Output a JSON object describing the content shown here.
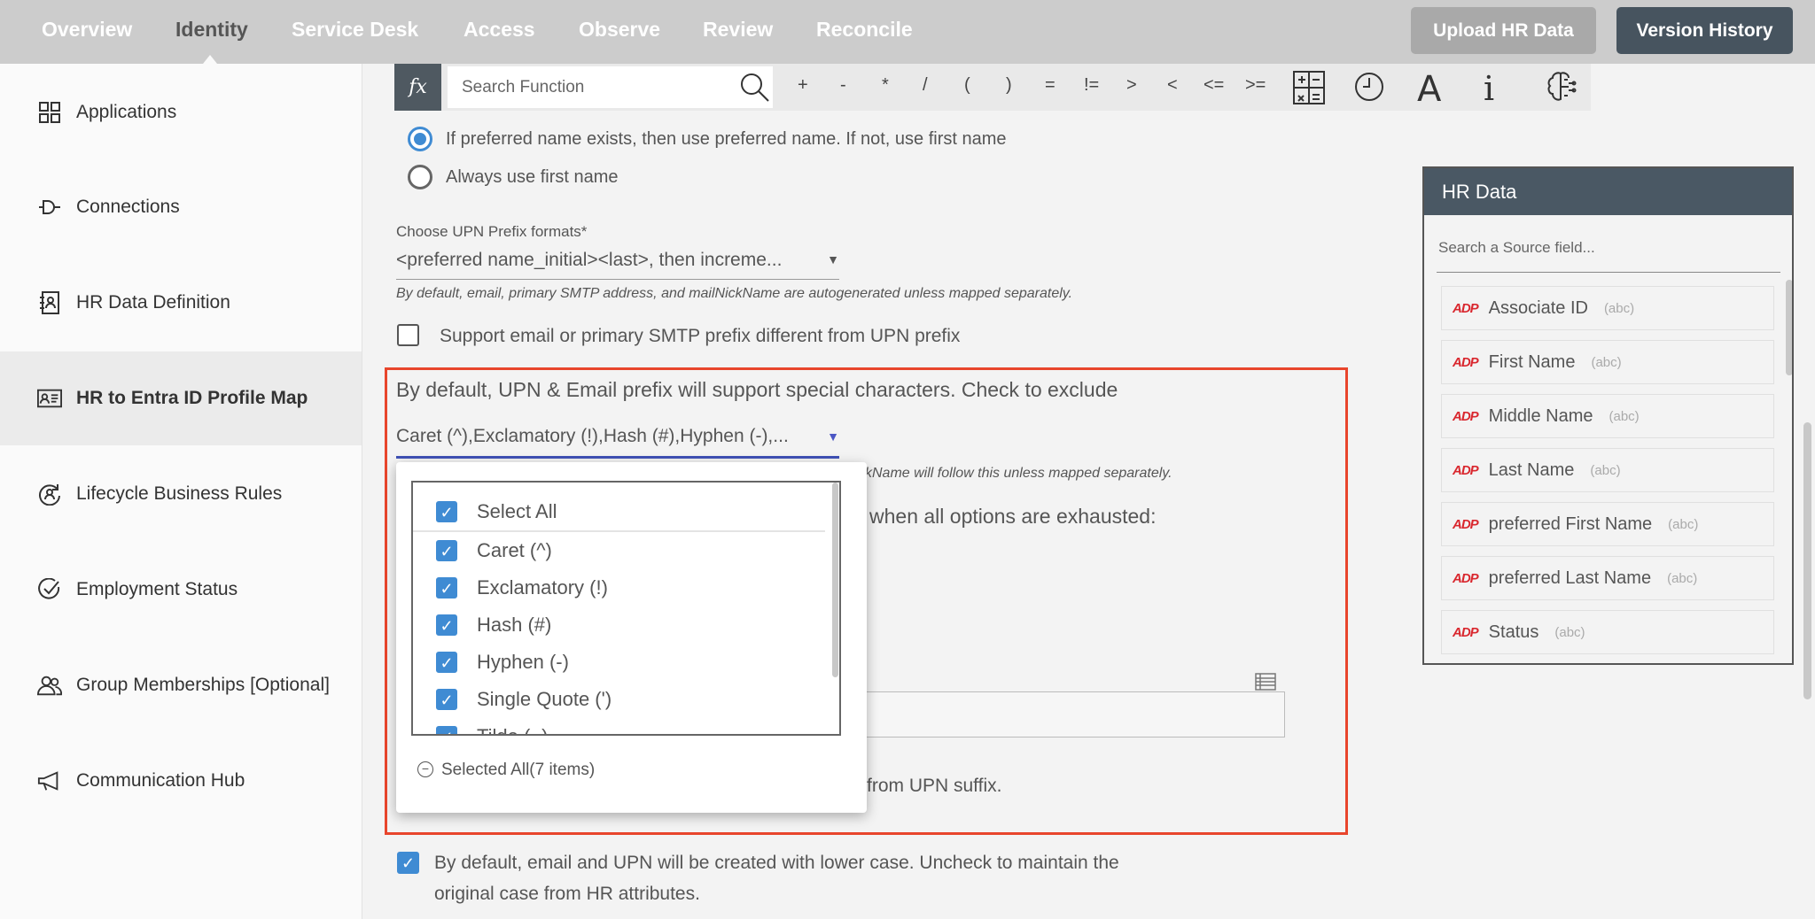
{
  "nav": {
    "tabs": [
      "Overview",
      "Identity",
      "Service Desk",
      "Access",
      "Observe",
      "Review",
      "Reconcile"
    ],
    "active": "Identity",
    "upload_label": "Upload HR Data",
    "version_label": "Version History"
  },
  "sidebar": {
    "items": [
      {
        "label": "Applications",
        "icon": "grid-icon"
      },
      {
        "label": "Connections",
        "icon": "plug-icon"
      },
      {
        "label": "HR Data Definition",
        "icon": "contact-book-icon"
      },
      {
        "label": "HR to Entra ID Profile Map",
        "icon": "id-card-icon"
      },
      {
        "label": "Lifecycle Business Rules",
        "icon": "lifecycle-icon"
      },
      {
        "label": "Employment Status",
        "icon": "check-circle-icon"
      },
      {
        "label": "Group Memberships [Optional]",
        "icon": "users-icon"
      },
      {
        "label": "Communication Hub",
        "icon": "megaphone-icon"
      }
    ],
    "active": "HR to Entra ID Profile Map"
  },
  "toolbar": {
    "fx_label": "fx",
    "search_placeholder": "Search Function",
    "operators": [
      "+",
      "-",
      "*",
      "/",
      "(",
      ")",
      "=",
      "!=",
      ">",
      "<",
      "<=",
      ">="
    ],
    "icons": [
      "calculator-icon",
      "clock-icon",
      "text-icon",
      "info-icon",
      "brain-icon"
    ]
  },
  "form": {
    "radio_preferred": "If preferred name exists, then use preferred name. If not, use first name",
    "radio_first": "Always use first name",
    "radio_selected": "preferred",
    "upn_label": "Choose UPN Prefix formats*",
    "upn_value": "<preferred name_initial><last>, then increme...",
    "upn_help": "By default, email, primary SMTP address, and mailNickName are autogenerated unless mapped separately.",
    "support_smtp_label": "Support email or primary SMTP prefix different from UPN prefix",
    "support_smtp_checked": false,
    "special_heading": "By default, UPN & Email prefix will support special characters. Check to exclude",
    "special_value": "Caret (^),Exclamatory (!),Hash (#),Hyphen (-),...",
    "special_help_fragment": "ckName will follow this unless mapped separately.",
    "exhausted_fragment": "when all options are exhausted:",
    "suffix_fragment": "from UPN suffix.",
    "lowercase_label_1": "By default, email and UPN will be created with lower case. Uncheck to maintain the",
    "lowercase_label_2": "original case from HR attributes.",
    "lowercase_checked": true
  },
  "dropdown": {
    "items": [
      {
        "label": "Select All",
        "checked": true
      },
      {
        "label": "Caret (^)",
        "checked": true
      },
      {
        "label": "Exclamatory (!)",
        "checked": true
      },
      {
        "label": "Hash (#)",
        "checked": true
      },
      {
        "label": "Hyphen (-)",
        "checked": true
      },
      {
        "label": "Single Quote (')",
        "checked": true
      },
      {
        "label": "Tilde (~)",
        "checked": true
      }
    ],
    "footer": "Selected All(7 items)"
  },
  "hr_panel": {
    "title": "HR Data",
    "search_placeholder": "Search a Source field...",
    "items": [
      {
        "name": "Associate ID",
        "type": "(abc)"
      },
      {
        "name": "First Name",
        "type": "(abc)"
      },
      {
        "name": "Middle Name",
        "type": "(abc)"
      },
      {
        "name": "Last Name",
        "type": "(abc)"
      },
      {
        "name": "preferred First Name",
        "type": "(abc)"
      },
      {
        "name": "preferred Last Name",
        "type": "(abc)"
      },
      {
        "name": "Status",
        "type": "(abc)"
      }
    ],
    "logo_text": "ADP"
  },
  "colors": {
    "accent": "#3f8bd3",
    "highlight_border": "#e8452c",
    "header_dark": "#4a5864",
    "select_underline": "#3f51b5"
  }
}
